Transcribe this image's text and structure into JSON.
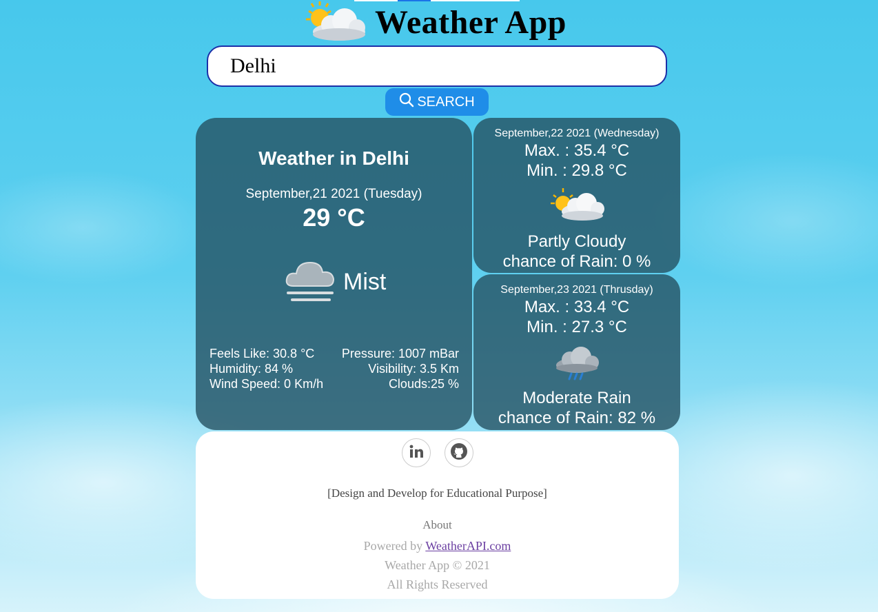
{
  "header": {
    "title": "Weather App",
    "logo_icon": "sun-behind-cloud-icon"
  },
  "search": {
    "value": "Delhi",
    "placeholder": "",
    "button_label": "SEARCH",
    "button_icon": "search-icon"
  },
  "colors": {
    "accent": "#1f8de8",
    "card_bg": "#234e5f",
    "input_border": "#1b2fa8"
  },
  "current": {
    "title": "Weather in Delhi",
    "date": "September,21 2021 (Tuesday)",
    "temperature": "29 °C",
    "condition": "Mist",
    "condition_icon": "fog-cloud-icon",
    "stats": [
      {
        "left": "Feels Like: 30.8 °C",
        "right": "Pressure: 1007 mBar"
      },
      {
        "left": "Humidity: 84 %",
        "right": "Visibility: 3.5 Km"
      },
      {
        "left": "Wind Speed: 0 Km/h",
        "right": "Clouds:25 %"
      }
    ]
  },
  "forecast": [
    {
      "date": "September,22 2021 (Wednesday)",
      "max": "Max. : 35.4 °C",
      "min": "Min. : 29.8 °C",
      "condition": "Partly Cloudy",
      "rain_chance": "chance of Rain: 0 %",
      "icon": "partly-cloudy-icon"
    },
    {
      "date": "September,23 2021 (Thrusday)",
      "max": "Max. : 33.4 °C",
      "min": "Min. : 27.3 °C",
      "condition": "Moderate Rain",
      "rain_chance": "chance of Rain: 82 %",
      "icon": "rain-cloud-icon"
    }
  ],
  "footer": {
    "social": [
      "linkedin-icon",
      "github-icon"
    ],
    "purpose": "[Design and Develop for Educational Purpose]",
    "about": "About",
    "powered_prefix": "Powered by ",
    "powered_link": "WeatherAPI.com",
    "copyright": "Weather App © 2021",
    "rights": "All Rights Reserved"
  }
}
